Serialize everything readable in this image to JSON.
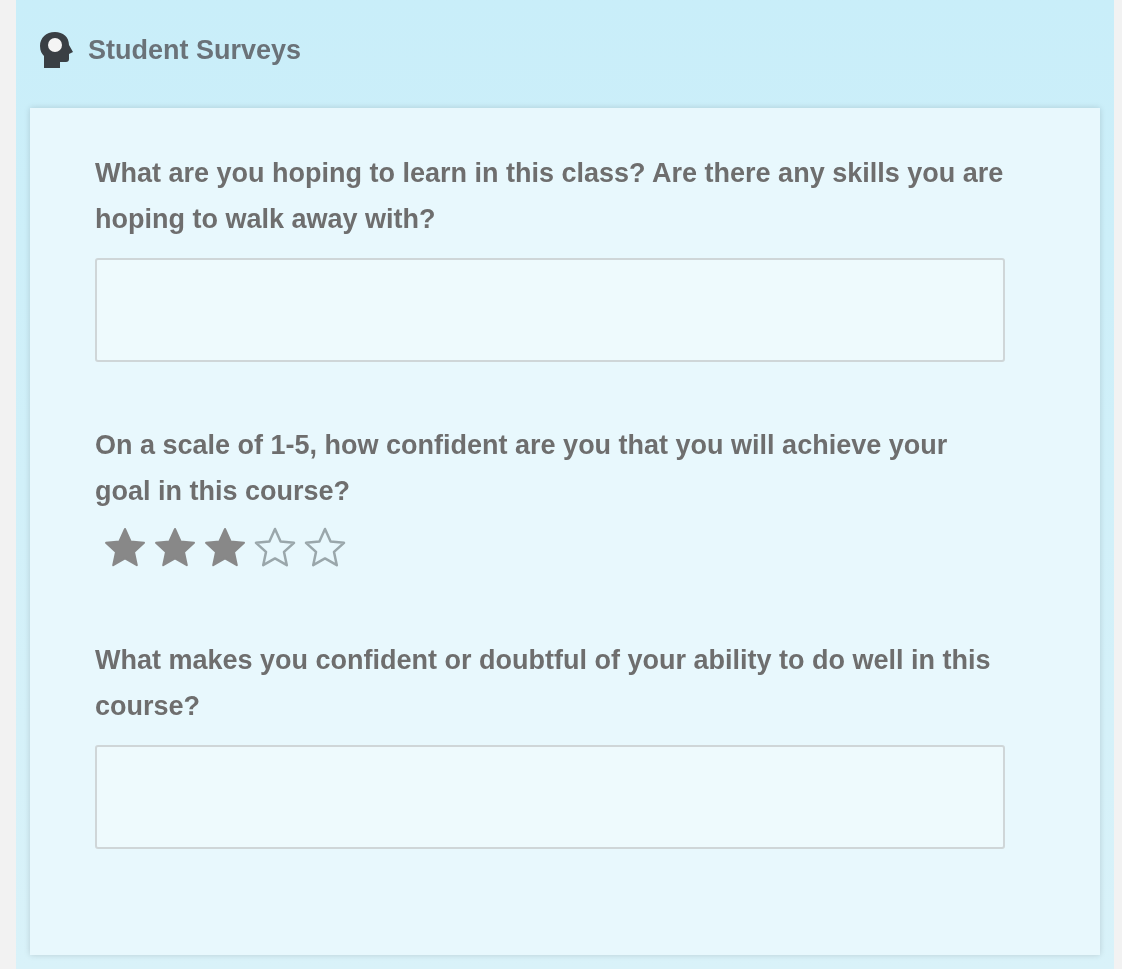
{
  "panel": {
    "title": "Student Surveys"
  },
  "questions": [
    {
      "kind": "text",
      "prompt": "What are you hoping to learn in this class?  Are there any skills you are hoping to walk away with?"
    },
    {
      "kind": "rating",
      "prompt": "On a scale of 1-5, how confident are you that you will achieve your goal in this course?",
      "stars": 3
    },
    {
      "kind": "text",
      "prompt": "What makes you confident or doubtful of your ability to do well in this course?"
    }
  ]
}
